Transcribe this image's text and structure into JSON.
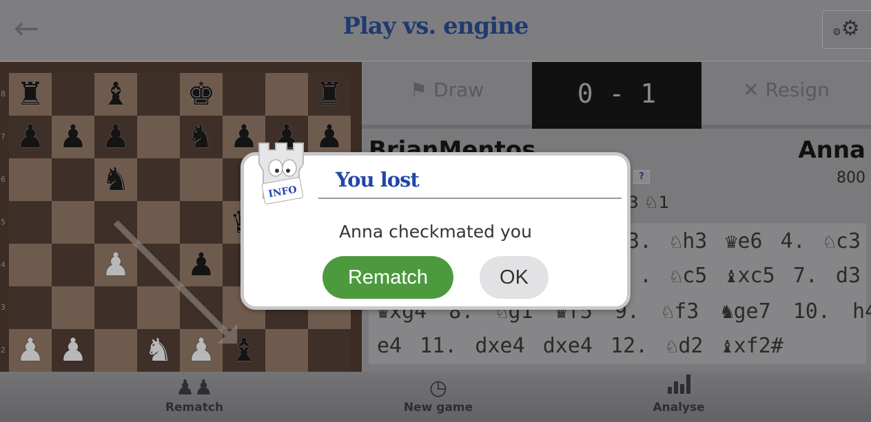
{
  "header": {
    "title": "Play vs. engine",
    "back_icon": "arrow-left-icon",
    "settings_icon": "gear-icon"
  },
  "board": {
    "rank_labels": [
      "8",
      "7",
      "6",
      "5",
      "4",
      "3",
      "2"
    ],
    "ranks": [
      "r.b.k..r",
      "ppp.nppp",
      "..n.....",
      ".....q..",
      "..P.p...",
      "........",
      "PP.NPb.."
    ],
    "last_move": {
      "from": "c5",
      "to": "f2"
    },
    "colors": {
      "light": "#6f5b4d",
      "dark": "#3e2f28"
    }
  },
  "tabs": {
    "draw": "Draw",
    "score": "0 - 1",
    "resign": "Resign"
  },
  "players": {
    "white": "BrianMentos",
    "black": "Anna",
    "black_rating": "800",
    "help_badge": "?",
    "captured": "♙3 ♘1"
  },
  "moves": [
    "3. ♘h3 ♛e6 4. ♘c3",
    ". ♘c5 ♝xc5 7. d3",
    "♛xg4 8. ♘g1 ♛f5 9. ♘f3 ♞ge7 10. h4",
    "e4 11. dxe4 dxe4 12. ♘d2 ♝xf2#"
  ],
  "bottom_bar": [
    {
      "label": "Rematch",
      "icon": "pieces-icon"
    },
    {
      "label": "New game",
      "icon": "clock-icon"
    },
    {
      "label": "Analyse",
      "icon": "bar-chart-icon"
    }
  ],
  "dialog": {
    "badge": "INFO",
    "title": "You lost",
    "message": "Anna checkmated you",
    "rematch": "Rematch",
    "ok": "OK",
    "accent": "#2347a8",
    "rematch_color": "#4d9a3e"
  }
}
